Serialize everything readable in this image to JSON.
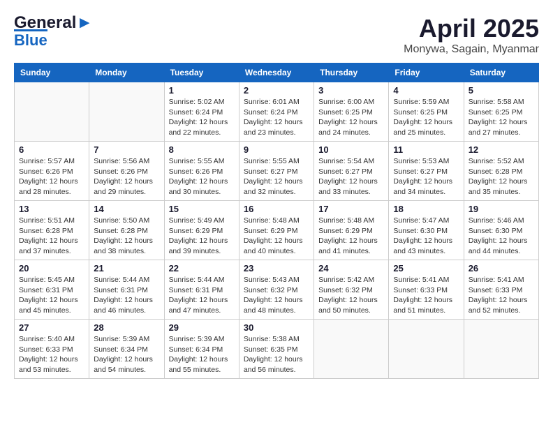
{
  "header": {
    "logo_line1": "General",
    "logo_line2": "Blue",
    "month": "April 2025",
    "location": "Monywa, Sagain, Myanmar"
  },
  "weekdays": [
    "Sunday",
    "Monday",
    "Tuesday",
    "Wednesday",
    "Thursday",
    "Friday",
    "Saturday"
  ],
  "weeks": [
    [
      {
        "day": "",
        "info": ""
      },
      {
        "day": "",
        "info": ""
      },
      {
        "day": "1",
        "sunrise": "5:02 AM",
        "sunset": "6:24 PM",
        "daylight": "12 hours and 22 minutes."
      },
      {
        "day": "2",
        "sunrise": "6:01 AM",
        "sunset": "6:24 PM",
        "daylight": "12 hours and 23 minutes."
      },
      {
        "day": "3",
        "sunrise": "6:00 AM",
        "sunset": "6:25 PM",
        "daylight": "12 hours and 24 minutes."
      },
      {
        "day": "4",
        "sunrise": "5:59 AM",
        "sunset": "6:25 PM",
        "daylight": "12 hours and 25 minutes."
      },
      {
        "day": "5",
        "sunrise": "5:58 AM",
        "sunset": "6:25 PM",
        "daylight": "12 hours and 27 minutes."
      }
    ],
    [
      {
        "day": "6",
        "sunrise": "5:57 AM",
        "sunset": "6:26 PM",
        "daylight": "12 hours and 28 minutes."
      },
      {
        "day": "7",
        "sunrise": "5:56 AM",
        "sunset": "6:26 PM",
        "daylight": "12 hours and 29 minutes."
      },
      {
        "day": "8",
        "sunrise": "5:55 AM",
        "sunset": "6:26 PM",
        "daylight": "12 hours and 30 minutes."
      },
      {
        "day": "9",
        "sunrise": "5:55 AM",
        "sunset": "6:27 PM",
        "daylight": "12 hours and 32 minutes."
      },
      {
        "day": "10",
        "sunrise": "5:54 AM",
        "sunset": "6:27 PM",
        "daylight": "12 hours and 33 minutes."
      },
      {
        "day": "11",
        "sunrise": "5:53 AM",
        "sunset": "6:27 PM",
        "daylight": "12 hours and 34 minutes."
      },
      {
        "day": "12",
        "sunrise": "5:52 AM",
        "sunset": "6:28 PM",
        "daylight": "12 hours and 35 minutes."
      }
    ],
    [
      {
        "day": "13",
        "sunrise": "5:51 AM",
        "sunset": "6:28 PM",
        "daylight": "12 hours and 37 minutes."
      },
      {
        "day": "14",
        "sunrise": "5:50 AM",
        "sunset": "6:28 PM",
        "daylight": "12 hours and 38 minutes."
      },
      {
        "day": "15",
        "sunrise": "5:49 AM",
        "sunset": "6:29 PM",
        "daylight": "12 hours and 39 minutes."
      },
      {
        "day": "16",
        "sunrise": "5:48 AM",
        "sunset": "6:29 PM",
        "daylight": "12 hours and 40 minutes."
      },
      {
        "day": "17",
        "sunrise": "5:48 AM",
        "sunset": "6:29 PM",
        "daylight": "12 hours and 41 minutes."
      },
      {
        "day": "18",
        "sunrise": "5:47 AM",
        "sunset": "6:30 PM",
        "daylight": "12 hours and 43 minutes."
      },
      {
        "day": "19",
        "sunrise": "5:46 AM",
        "sunset": "6:30 PM",
        "daylight": "12 hours and 44 minutes."
      }
    ],
    [
      {
        "day": "20",
        "sunrise": "5:45 AM",
        "sunset": "6:31 PM",
        "daylight": "12 hours and 45 minutes."
      },
      {
        "day": "21",
        "sunrise": "5:44 AM",
        "sunset": "6:31 PM",
        "daylight": "12 hours and 46 minutes."
      },
      {
        "day": "22",
        "sunrise": "5:44 AM",
        "sunset": "6:31 PM",
        "daylight": "12 hours and 47 minutes."
      },
      {
        "day": "23",
        "sunrise": "5:43 AM",
        "sunset": "6:32 PM",
        "daylight": "12 hours and 48 minutes."
      },
      {
        "day": "24",
        "sunrise": "5:42 AM",
        "sunset": "6:32 PM",
        "daylight": "12 hours and 50 minutes."
      },
      {
        "day": "25",
        "sunrise": "5:41 AM",
        "sunset": "6:33 PM",
        "daylight": "12 hours and 51 minutes."
      },
      {
        "day": "26",
        "sunrise": "5:41 AM",
        "sunset": "6:33 PM",
        "daylight": "12 hours and 52 minutes."
      }
    ],
    [
      {
        "day": "27",
        "sunrise": "5:40 AM",
        "sunset": "6:33 PM",
        "daylight": "12 hours and 53 minutes."
      },
      {
        "day": "28",
        "sunrise": "5:39 AM",
        "sunset": "6:34 PM",
        "daylight": "12 hours and 54 minutes."
      },
      {
        "day": "29",
        "sunrise": "5:39 AM",
        "sunset": "6:34 PM",
        "daylight": "12 hours and 55 minutes."
      },
      {
        "day": "30",
        "sunrise": "5:38 AM",
        "sunset": "6:35 PM",
        "daylight": "12 hours and 56 minutes."
      },
      {
        "day": "",
        "info": ""
      },
      {
        "day": "",
        "info": ""
      },
      {
        "day": "",
        "info": ""
      }
    ]
  ],
  "labels": {
    "sunrise": "Sunrise: ",
    "sunset": "Sunset: ",
    "daylight": "Daylight: "
  }
}
